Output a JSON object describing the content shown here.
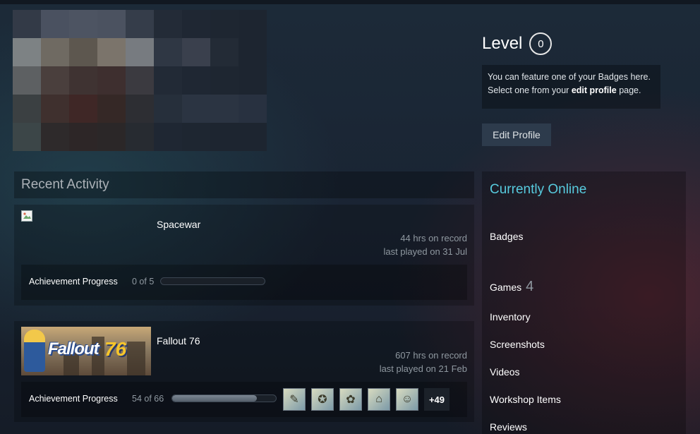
{
  "profile": {
    "level_label": "Level",
    "level_value": "0",
    "badge_note_1": "You can feature one of your Badges here.",
    "badge_note_2a": "Select one from your ",
    "badge_note_link": "edit profile",
    "badge_note_2b": " page.",
    "edit_button": "Edit Profile"
  },
  "recent_activity": {
    "title": "Recent Activity",
    "games": [
      {
        "name": "Spacewar",
        "hours": "44 hrs on record",
        "last_played": "last played on 31 Jul",
        "achievement_label": "Achievement Progress",
        "achievement_count": "0 of 5",
        "achievement_progress": 0
      },
      {
        "name": "Fallout 76",
        "capsule_text": "Fallout",
        "capsule_number": "76",
        "hours": "607 hrs on record",
        "last_played": "last played on 21 Feb",
        "achievement_label": "Achievement Progress",
        "achievement_count": "54 of 66",
        "achievement_progress": 0.818,
        "achievement_more": "+49"
      }
    ]
  },
  "sidebar": {
    "status": "Currently Online",
    "badges": "Badges",
    "games": "Games",
    "games_count": "4",
    "inventory": "Inventory",
    "screenshots": "Screenshots",
    "videos": "Videos",
    "workshop": "Workshop Items",
    "reviews": "Reviews"
  },
  "colors": {
    "accent_online": "#57cbde",
    "background": "#1b2838"
  }
}
